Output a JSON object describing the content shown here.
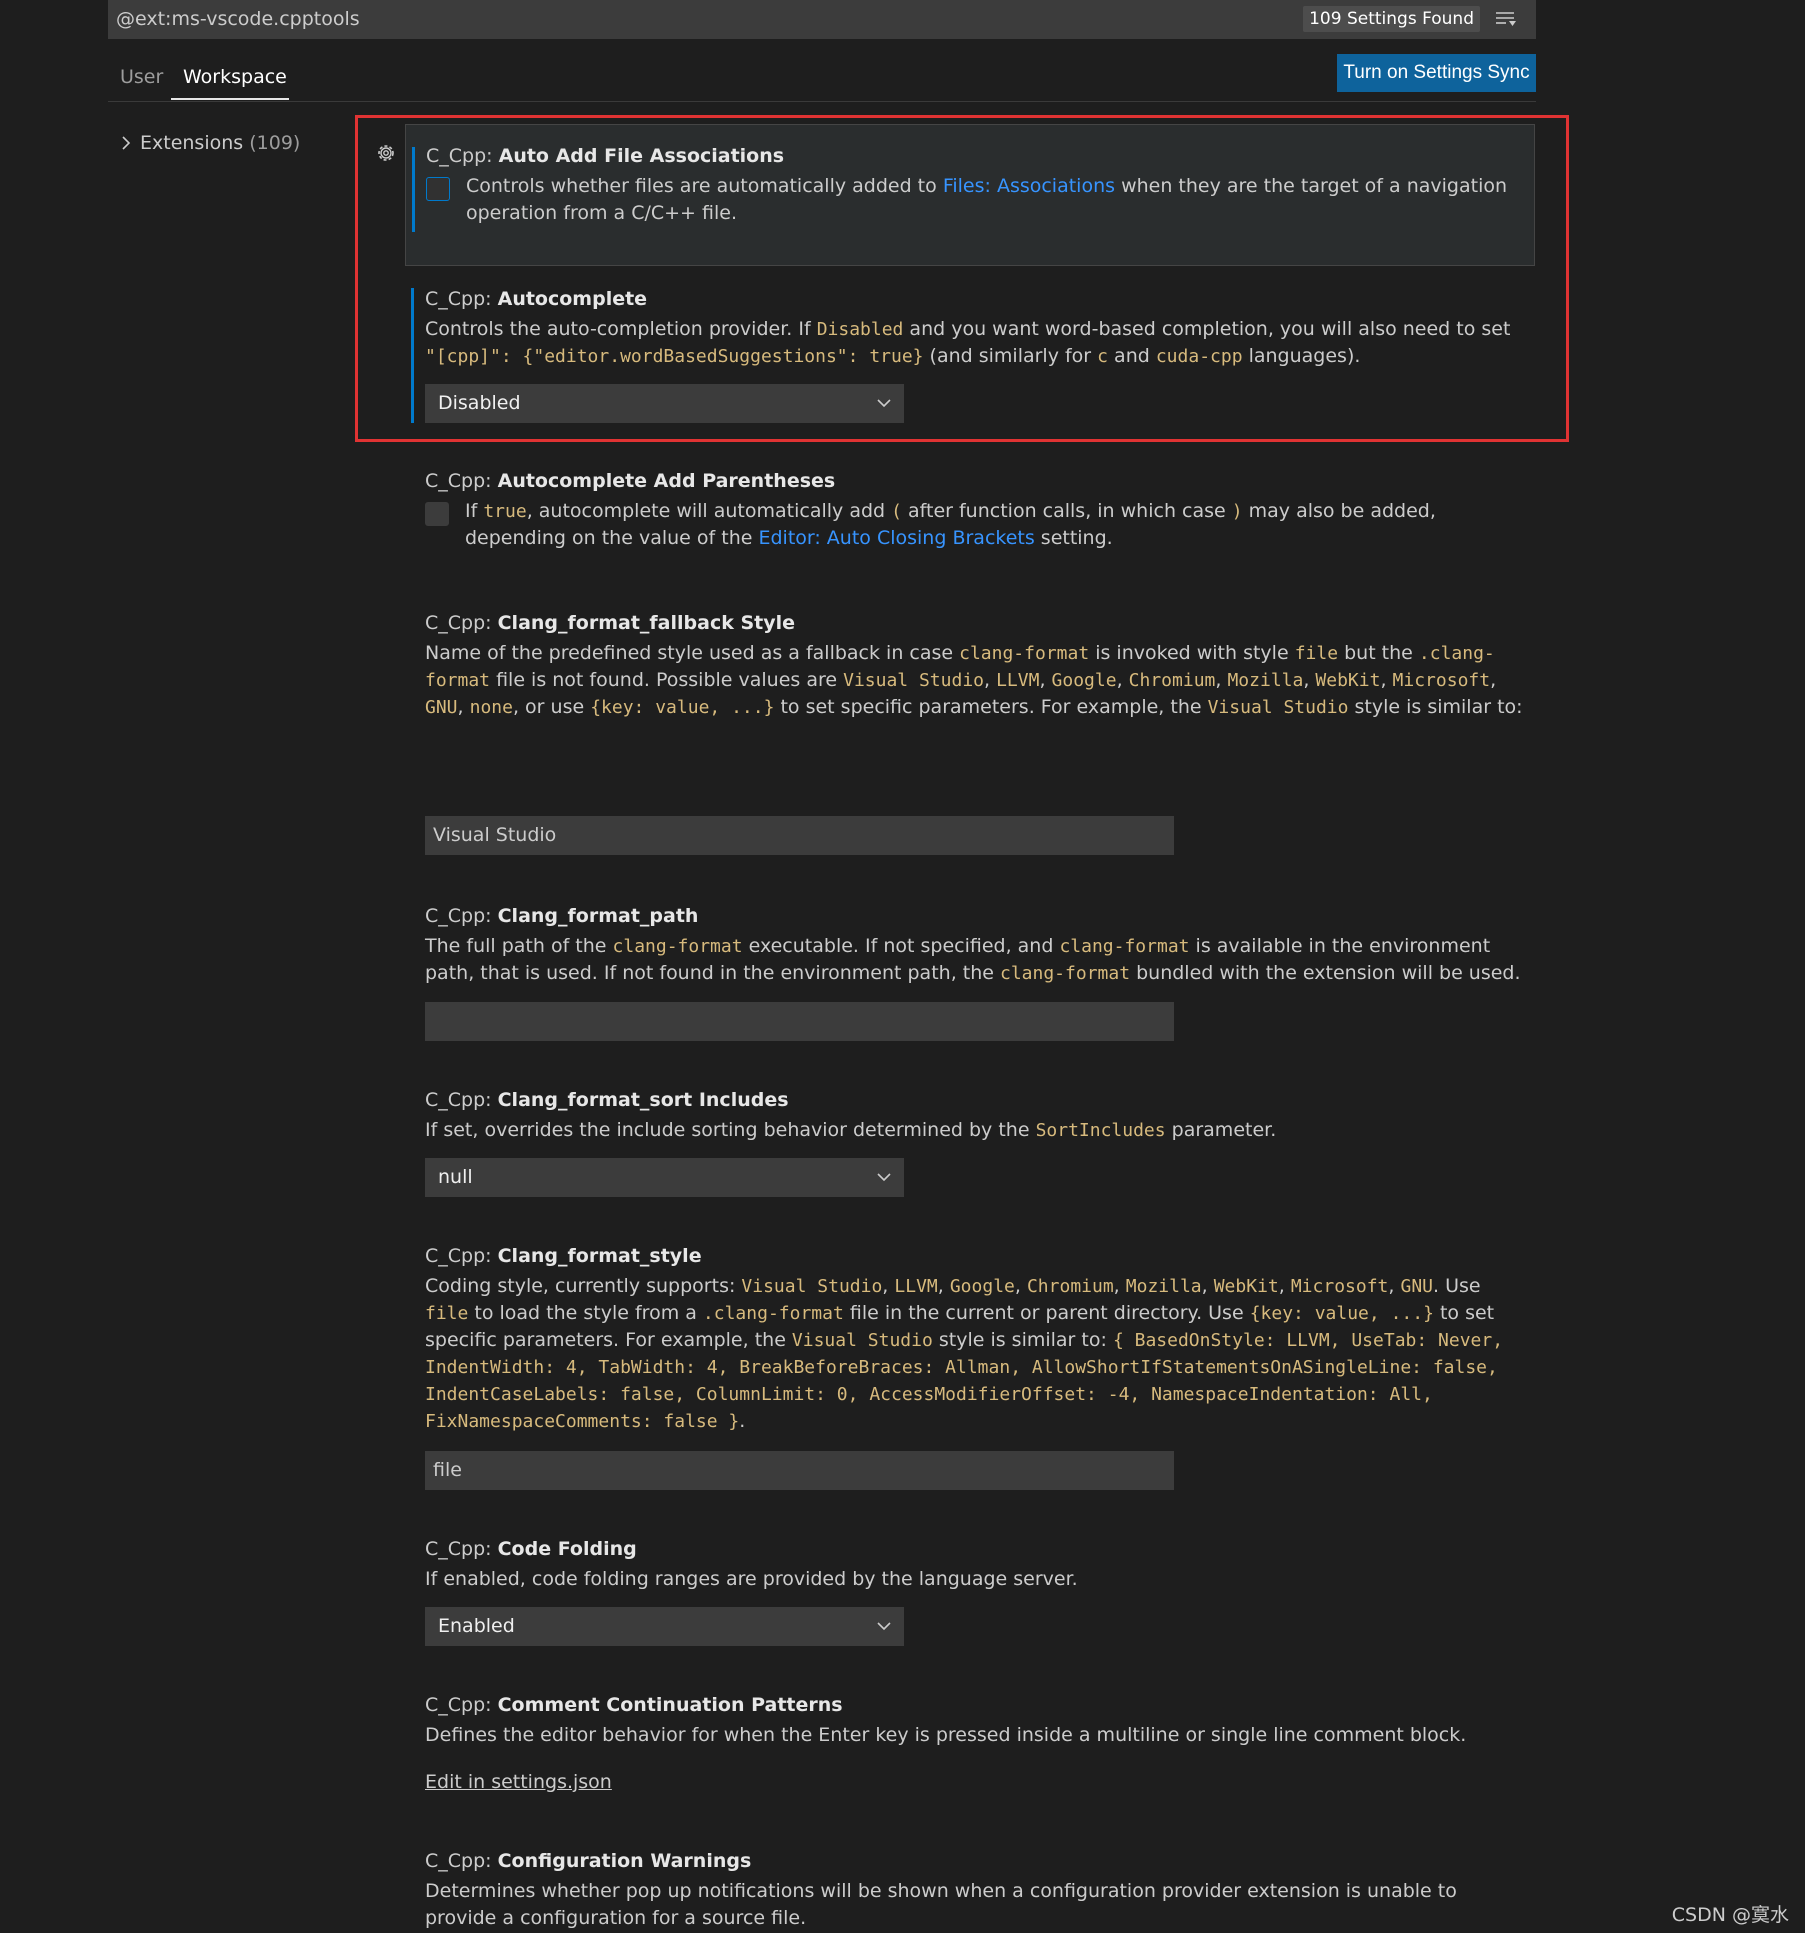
{
  "search": {
    "query": "@ext:ms-vscode.cpptools",
    "results": "109 Settings Found"
  },
  "tabs": {
    "user": "User",
    "workspace": "Workspace"
  },
  "sync_button": "Turn on Settings Sync",
  "toc": {
    "label": "Extensions",
    "count": "(109)"
  },
  "settings": [
    {
      "category": "C_Cpp: ",
      "name": "Auto Add File Associations",
      "desc": [
        "Controls whether files are automatically added to ",
        "Files: Associations",
        " when they are the target of a navigation operation from a C/C++ file."
      ],
      "checked": false
    },
    {
      "category": "C_Cpp: ",
      "name": "Autocomplete",
      "desc": [
        "Controls the auto-completion provider. If ",
        "Disabled",
        " and you want word-based completion, you will also need to set ",
        "\"[cpp]\": {\"editor.wordBasedSuggestions\": true}",
        " (and similarly for ",
        "c",
        " and ",
        "cuda-cpp",
        " languages)."
      ],
      "value": "Disabled"
    },
    {
      "category": "C_Cpp: ",
      "name": "Autocomplete Add Parentheses",
      "desc": [
        "If ",
        "true",
        ", autocomplete will automatically add ",
        "(",
        " after function calls, in which case ",
        ")",
        " may also be added, depending on the value of the ",
        "Editor: Auto Closing Brackets",
        " setting."
      ],
      "checked": false
    },
    {
      "category": "C_Cpp: ",
      "name": "Clang_format_fallback Style",
      "desc": [
        "Name of the predefined style used as a fallback in case ",
        "clang-format",
        " is invoked with style ",
        "file",
        " but the ",
        ".clang-format",
        " file is not found. Possible values are ",
        "Visual Studio",
        ", ",
        "LLVM",
        ", ",
        "Google",
        ", ",
        "Chromium",
        ", ",
        "Mozilla",
        ", ",
        "WebKit",
        ", ",
        "Microsoft",
        ", ",
        "GNU",
        ", ",
        "none",
        ", or use ",
        "{key: value, ...}",
        " to set specific parameters. For example, the ",
        "Visual Studio",
        " style is similar to: ",
        "{ BasedOnStyle: LLVM, UseTab: Never, IndentWidth: 4, TabWidth: 4, BreakBeforeBraces: Allman, AllowShortIfStatementsOnASingleLine: false, IndentCaseLabels: false, ColumnLimit: 0, AccessModifierOffset: -4, NamespaceIndentation: All, FixNamespaceComments: false }",
        "."
      ],
      "value": "Visual Studio"
    },
    {
      "category": "C_Cpp: ",
      "name": "Clang_format_path",
      "desc": [
        "The full path of the ",
        "clang-format",
        " executable. If not specified, and ",
        "clang-format",
        " is available in the environment path, that is used. If not found in the environment path, the ",
        "clang-format",
        " bundled with the extension will be used."
      ],
      "value": ""
    },
    {
      "category": "C_Cpp: ",
      "name": "Clang_format_sort Includes",
      "desc": [
        "If set, overrides the include sorting behavior determined by the ",
        "SortIncludes",
        " parameter."
      ],
      "value": "null"
    },
    {
      "category": "C_Cpp: ",
      "name": "Clang_format_style",
      "desc": [
        "Coding style, currently supports: ",
        "Visual Studio",
        ", ",
        "LLVM",
        ", ",
        "Google",
        ", ",
        "Chromium",
        ", ",
        "Mozilla",
        ", ",
        "WebKit",
        ", ",
        "Microsoft",
        ", ",
        "GNU",
        ". Use ",
        "file",
        " to load the style from a ",
        ".clang-format",
        " file in the current or parent directory. Use ",
        "{key: value, ...}",
        " to set specific parameters. For example, the ",
        "Visual Studio",
        " style is similar to: ",
        "{ BasedOnStyle: LLVM, UseTab: Never, IndentWidth: 4, TabWidth: 4, BreakBeforeBraces: Allman, AllowShortIfStatementsOnASingleLine: false, IndentCaseLabels: false, ColumnLimit: 0, AccessModifierOffset: -4, NamespaceIndentation: All, FixNamespaceComments: false }",
        "."
      ],
      "value": "file"
    },
    {
      "category": "C_Cpp: ",
      "name": "Code Folding",
      "desc": [
        "If enabled, code folding ranges are provided by the language server."
      ],
      "value": "Enabled"
    },
    {
      "category": "C_Cpp: ",
      "name": "Comment Continuation Patterns",
      "desc": [
        "Defines the editor behavior for when the Enter key is pressed inside a multiline or single line comment block."
      ],
      "link": "Edit in settings.json"
    },
    {
      "category": "C_Cpp: ",
      "name": "Configuration Warnings",
      "desc": [
        "Determines whether pop up notifications will be shown when a configuration provider extension is unable to provide a configuration for a source file."
      ]
    }
  ],
  "watermark": "CSDN @寞水",
  "colors": {
    "accent": "#007acc",
    "button": "#0e639c",
    "highlight_box": "#e03333",
    "code": "#d7ba7d",
    "link": "#3794ff"
  }
}
